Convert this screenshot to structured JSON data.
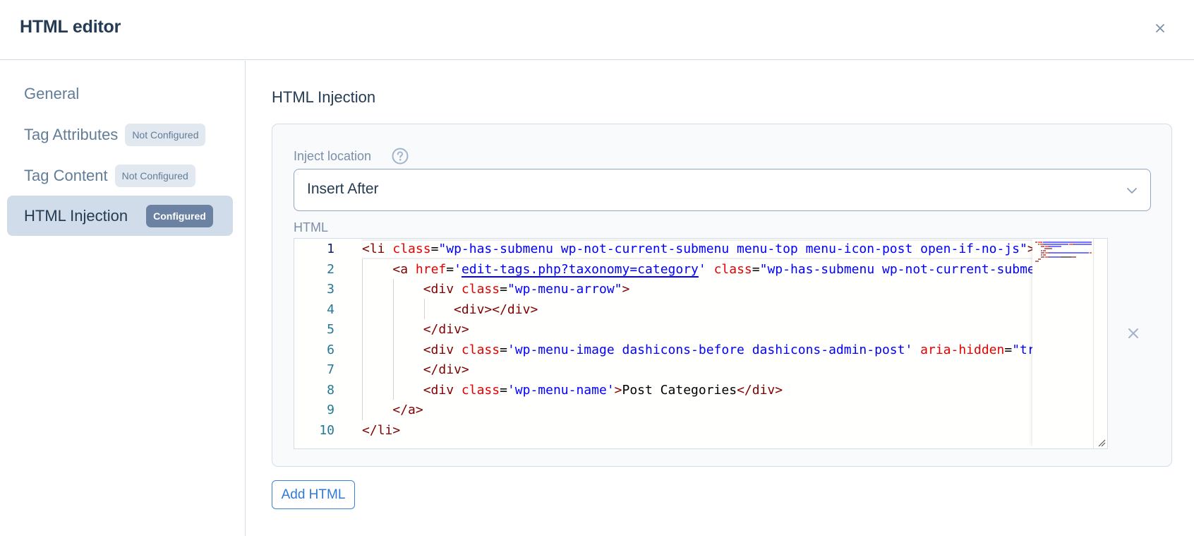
{
  "header": {
    "title": "HTML editor",
    "close_icon": "close-icon"
  },
  "sidebar": {
    "items": [
      {
        "label": "General",
        "badge": null,
        "active": false
      },
      {
        "label": "Tag Attributes",
        "badge": "Not Configured",
        "active": false
      },
      {
        "label": "Tag Content",
        "badge": "Not Configured",
        "active": false
      },
      {
        "label": "HTML Injection",
        "badge": "Configured",
        "active": true
      }
    ]
  },
  "main": {
    "heading": "HTML Injection",
    "inject_location": {
      "label": "Inject location",
      "help_icon": "question-circle-icon",
      "value": "Insert After",
      "chevron_icon": "chevron-down-icon"
    },
    "html_field": {
      "label": "HTML",
      "current_line": 1,
      "line_numbers": [
        "1",
        "2",
        "3",
        "4",
        "5",
        "6",
        "7",
        "8",
        "9",
        "10"
      ],
      "lines": [
        [
          [
            "br",
            "<"
          ],
          [
            "tag",
            "li"
          ],
          [
            "txt",
            " "
          ],
          [
            "attr",
            "class"
          ],
          [
            "txt",
            "="
          ],
          [
            "val",
            "\"wp-has-submenu wp-not-current-submenu menu-top menu-icon-post open-if-no-js\""
          ],
          [
            "br",
            ">"
          ]
        ],
        [
          [
            "txt",
            "    "
          ],
          [
            "br",
            "<"
          ],
          [
            "tag",
            "a"
          ],
          [
            "txt",
            " "
          ],
          [
            "attr",
            "href"
          ],
          [
            "txt",
            "="
          ],
          [
            "val",
            "'"
          ],
          [
            "link",
            "edit-tags.php?taxonomy=category"
          ],
          [
            "val",
            "'"
          ],
          [
            "txt",
            " "
          ],
          [
            "attr",
            "class"
          ],
          [
            "txt",
            "="
          ],
          [
            "val",
            "\"wp-has-submenu wp-not-current-submenu\""
          ]
        ],
        [
          [
            "txt",
            "        "
          ],
          [
            "br",
            "<"
          ],
          [
            "tag",
            "div"
          ],
          [
            "txt",
            " "
          ],
          [
            "attr",
            "class"
          ],
          [
            "txt",
            "="
          ],
          [
            "val",
            "\"wp-menu-arrow\""
          ],
          [
            "br",
            ">"
          ]
        ],
        [
          [
            "txt",
            "            "
          ],
          [
            "br",
            "<"
          ],
          [
            "tag",
            "div"
          ],
          [
            "br",
            "></"
          ],
          [
            "tag",
            "div"
          ],
          [
            "br",
            ">"
          ]
        ],
        [
          [
            "txt",
            "        "
          ],
          [
            "br",
            "</"
          ],
          [
            "tag",
            "div"
          ],
          [
            "br",
            ">"
          ]
        ],
        [
          [
            "txt",
            "        "
          ],
          [
            "br",
            "<"
          ],
          [
            "tag",
            "div"
          ],
          [
            "txt",
            " "
          ],
          [
            "attr",
            "class"
          ],
          [
            "txt",
            "="
          ],
          [
            "val",
            "'wp-menu-image dashicons-before dashicons-admin-post'"
          ],
          [
            "txt",
            " "
          ],
          [
            "attr",
            "aria-hidden"
          ],
          [
            "txt",
            "="
          ],
          [
            "val",
            "\"true\""
          ],
          [
            "br",
            ">"
          ]
        ],
        [
          [
            "txt",
            "        "
          ],
          [
            "br",
            "</"
          ],
          [
            "tag",
            "div"
          ],
          [
            "br",
            ">"
          ]
        ],
        [
          [
            "txt",
            "        "
          ],
          [
            "br",
            "<"
          ],
          [
            "tag",
            "div"
          ],
          [
            "txt",
            " "
          ],
          [
            "attr",
            "class"
          ],
          [
            "txt",
            "="
          ],
          [
            "val",
            "'wp-menu-name'"
          ],
          [
            "br",
            ">"
          ],
          [
            "txt",
            "Post Categories"
          ],
          [
            "br",
            "</"
          ],
          [
            "tag",
            "div"
          ],
          [
            "br",
            ">"
          ]
        ],
        [
          [
            "txt",
            "    "
          ],
          [
            "br",
            "</"
          ],
          [
            "tag",
            "a"
          ],
          [
            "br",
            ">"
          ]
        ],
        [
          [
            "br",
            "</"
          ],
          [
            "tag",
            "li"
          ],
          [
            "br",
            ">"
          ]
        ]
      ],
      "remove_icon": "close-icon"
    },
    "add_button_label": "Add HTML"
  },
  "colors": {
    "accent": "#2f7ad6",
    "badge_configured": "#6b82a3",
    "badge_not_configured": "#e2e8f0",
    "active_item": "#d1dcea",
    "syntax_tag": "#800000",
    "syntax_attr": "#e50000",
    "syntax_value": "#0000ff",
    "line_number": "#237893"
  }
}
